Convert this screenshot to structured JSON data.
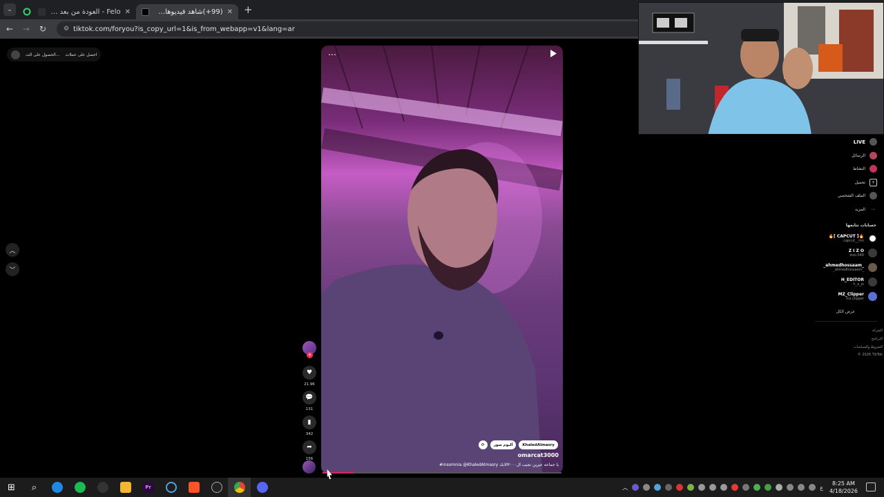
{
  "browser": {
    "tabs": [
      {
        "title": "Felo - العودة من بعد الغياب",
        "active": false
      },
      {
        "title": "(99+)شاهد فيديوهات متصدرة |",
        "active": true
      }
    ],
    "new_tab": "+",
    "url": "tiktok.com/foryou?is_copy_url=1&is_from_webapp=v1&lang=ar"
  },
  "top_pill": {
    "get_coins": "احصل على عملات",
    "get_app": "الحصول على الت..."
  },
  "video": {
    "chip_mention": "KhaledAlmasry",
    "chip_label": "ألبوم صور",
    "author": "omarcat3000",
    "description": "#insomnia @KhaledAlmasry يا جماعه عيزين نجيب ال٣٠٠٠الابك",
    "progress": 0.13
  },
  "actions": {
    "likes": "21.9K",
    "comments": "131",
    "bookmarks": "342",
    "shares": "156"
  },
  "right_nav": {
    "live": "LIVE",
    "items": [
      "الرسائل",
      "النشاط",
      "تحميل",
      "الملف الشخصي",
      "المزيد"
    ]
  },
  "following": {
    "title": "حسابات تتابعها",
    "accounts": [
      {
        "name": "🔥[ CAPCUT ]🔥",
        "user": "capcut__mn"
      },
      {
        "name": "Z I Z O",
        "user": "zizo.040"
      },
      {
        "name": "_ahmedhossaam_",
        "user": "_ahmedhossaam_"
      },
      {
        "name": "H_EDITOR",
        "user": "h_a_jx"
      },
      {
        "name": "MZ_Clipper",
        "user": "mz.clipper"
      }
    ],
    "show_all": "عرض الكل"
  },
  "footer": [
    "الشركة",
    "البرنامج",
    "الشروط والسياسات",
    "© 2026 TikTok"
  ],
  "taskbar": {
    "time": "8:25 AM",
    "date": "4/18/2026",
    "lang": "ع"
  },
  "colors": {
    "accent": "#fe2c55",
    "video_top": "#4b1a3f",
    "video_mid": "#c45cc4"
  }
}
